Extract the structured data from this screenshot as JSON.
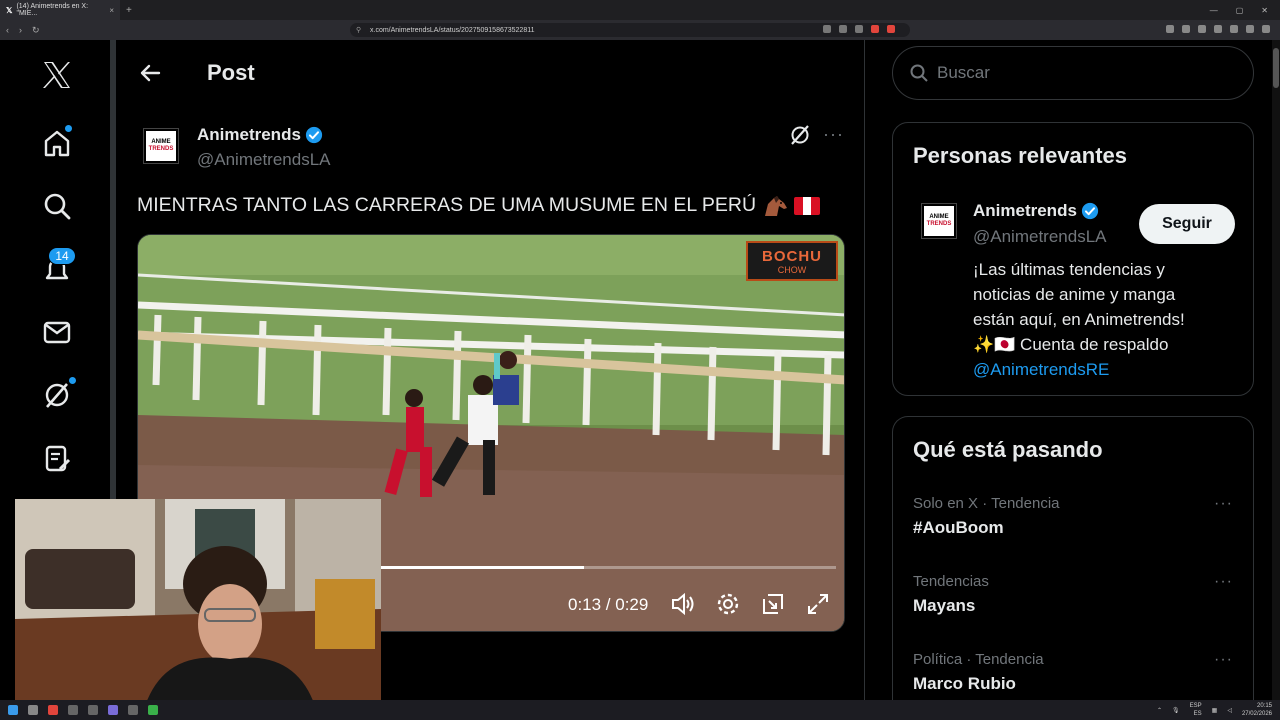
{
  "browser": {
    "tab_title": "(14) Animetrends en X: \"MIE...",
    "url": "x.com/AnimetrendsLA/status/2027509158673522811",
    "tab_close": "×",
    "new_tab": "+"
  },
  "nav": {
    "items": [
      "x-logo-icon",
      "home-icon",
      "search-icon",
      "notifications-icon",
      "messages-icon",
      "grok-icon",
      "lists-icon"
    ],
    "notifications_count": "14"
  },
  "post": {
    "header_title": "Post",
    "author": {
      "name": "Animetrends",
      "handle": "@AnimetrendsLA",
      "avatar_text_top": "ANIME",
      "avatar_text_bottom": "TRENDS"
    },
    "text": "MIENTRAS TANTO LAS CARRERAS DE UMA MUSUME EN EL PERÚ",
    "video": {
      "time": "0:13 / 0:29",
      "progress": 0.45,
      "watermark_top": "BOCHU",
      "watermark_bottom": "CHOW"
    }
  },
  "sidebar": {
    "search_placeholder": "Buscar",
    "relevant": {
      "title": "Personas relevantes",
      "name": "Animetrends",
      "handle": "@AnimetrendsLA",
      "follow_label": "Seguir",
      "bio_lines": [
        "¡Las últimas tendencias y",
        "noticias de anime y manga",
        "están aquí, en Animetrends!",
        "✨🇯🇵 Cuenta de respaldo"
      ],
      "bio_link": "@AnimetrendsRE"
    },
    "trending": {
      "title": "Qué está pasando",
      "items": [
        {
          "meta": "Solo en X · Tendencia",
          "name": "#AouBoom"
        },
        {
          "meta": "Tendencias",
          "name": "Mayans"
        },
        {
          "meta": "Política · Tendencia",
          "name": "Marco Rubio"
        }
      ]
    }
  },
  "taskbar": {
    "lang_top": "ESP",
    "lang_bottom": "ES",
    "time": "20:15",
    "date": "27/02/2026"
  },
  "colors": {
    "accent": "#1d9bf0",
    "background": "#000000",
    "border": "#2f3336",
    "muted": "#71767b"
  }
}
